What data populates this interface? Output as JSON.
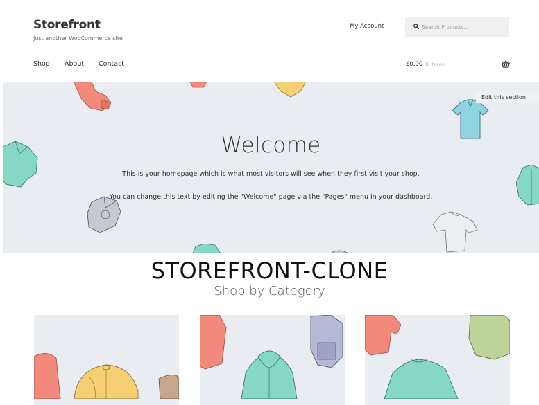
{
  "header": {
    "site_title": "Storefront",
    "tagline": "Just another WooCommerce site",
    "my_account": "My Account",
    "search_placeholder": "Search Products…"
  },
  "nav": {
    "items": [
      {
        "label": "Shop"
      },
      {
        "label": "About"
      },
      {
        "label": "Contact"
      }
    ]
  },
  "cart": {
    "amount": "£0.00",
    "count": "0 items"
  },
  "hero": {
    "edit_label": "Edit this section",
    "title": "Welcome",
    "line1": "This is your homepage which is what most visitors will see when they first visit your shop.",
    "line2": "You can change this text by editing the \"Welcome\" page via the \"Pages\" menu in your dashboard."
  },
  "overlay_heading": "STOREFRONT-CLONE",
  "categories": {
    "title": "Shop by Category"
  },
  "colors": {
    "hero_bg": "#e9edf1",
    "teal": "#7ed6c4",
    "coral": "#f08a7a",
    "yellow": "#f5c96b",
    "grey": "#b9bec6"
  }
}
